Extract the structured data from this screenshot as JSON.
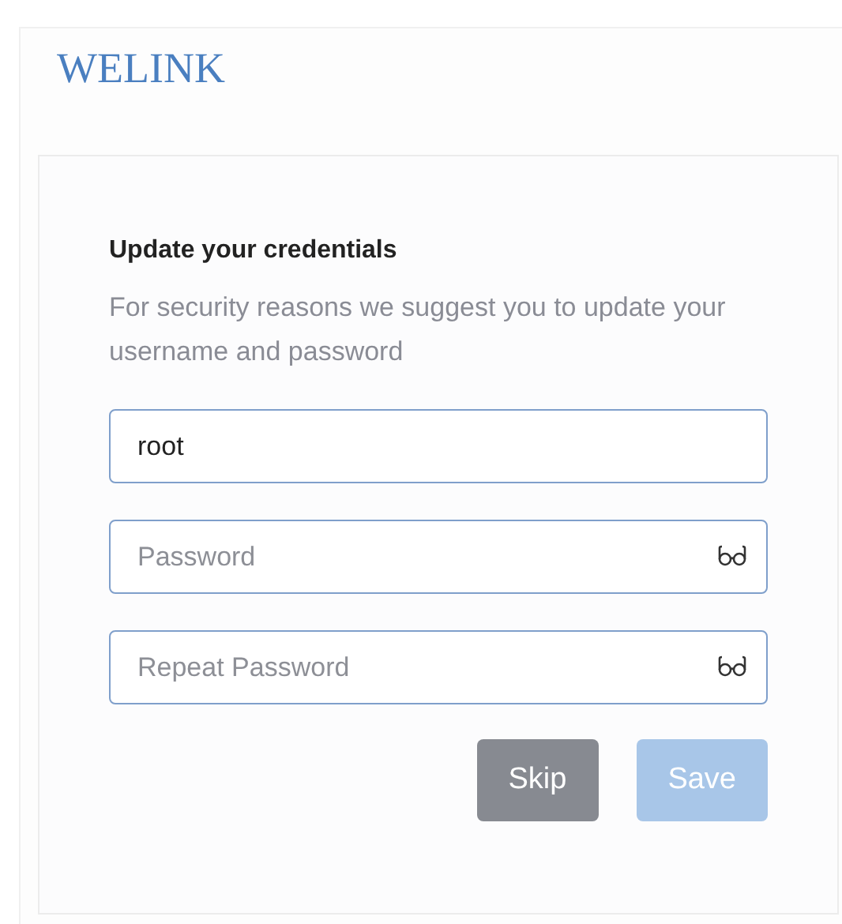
{
  "logo": "WELINK",
  "card": {
    "title": "Update your credentials",
    "description": "For security reasons we suggest you to update your username and password",
    "fields": [
      {
        "kind": "text",
        "value": "root"
      },
      {
        "kind": "password",
        "placeholder": "Password"
      },
      {
        "kind": "password",
        "placeholder": "Repeat Password"
      }
    ],
    "buttons": [
      {
        "kind": "secondary",
        "label": "Skip",
        "disabled": false
      },
      {
        "kind": "primary",
        "label": "Save",
        "disabled": true
      }
    ]
  }
}
